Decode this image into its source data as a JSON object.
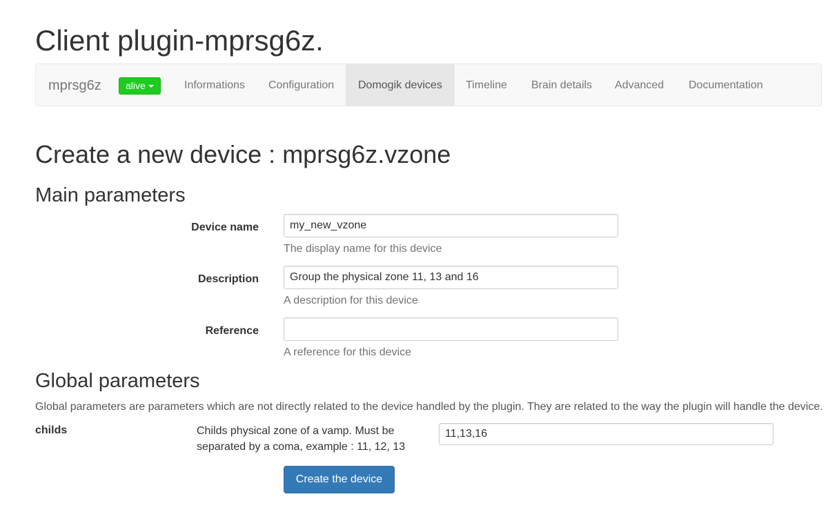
{
  "page": {
    "title": "Client plugin-mprsg6z."
  },
  "navbar": {
    "brand": "mprsg6z",
    "status": {
      "label": "alive",
      "color": "#1ecb1e"
    },
    "tabs": [
      {
        "label": "Informations"
      },
      {
        "label": "Configuration"
      },
      {
        "label": "Domogik devices",
        "active": true
      },
      {
        "label": "Timeline"
      },
      {
        "label": "Brain details"
      },
      {
        "label": "Advanced"
      },
      {
        "label": "Documentation"
      }
    ]
  },
  "form": {
    "title": "Create a new device : mprsg6z.vzone",
    "main_title": "Main parameters",
    "fields": [
      {
        "label": "Device name",
        "value": "my_new_vzone",
        "help": "The display name for this device"
      },
      {
        "label": "Description",
        "value": "Group the physical zone 11, 13 and 16",
        "help": "A description for this device"
      },
      {
        "label": "Reference",
        "value": "",
        "help": "A reference for this device"
      }
    ],
    "global_title": "Global parameters",
    "global_description": "Global parameters are parameters which are not directly related to the device handled by the plugin. They are related to the way the plugin will handle the device.",
    "global_params": [
      {
        "name": "childs",
        "description": "Childs physical zone of a vamp. Must be separated by a coma, example : 11, 12, 13",
        "value": "11,13,16"
      }
    ],
    "submit_label": "Create the device"
  },
  "colors": {
    "primary": "#337ab7",
    "navbar_bg": "#f8f8f8",
    "active_tab_bg": "#e7e7e7"
  }
}
